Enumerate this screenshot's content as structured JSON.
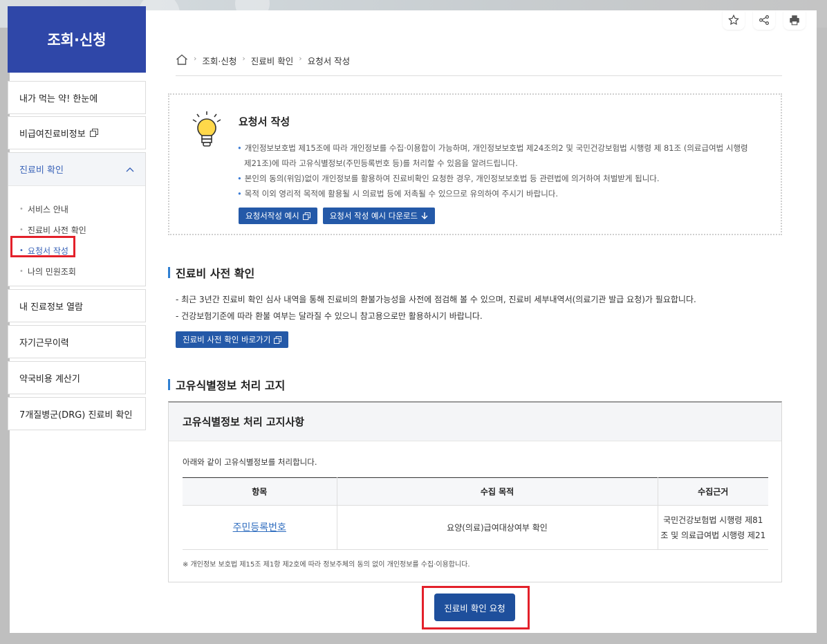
{
  "sidebar": {
    "title": "조회·신청",
    "items": [
      {
        "label": "내가 먹는 약! 한눈에"
      },
      {
        "label": "비급여진료비정보"
      },
      {
        "label": "진료비 확인"
      },
      {
        "label": "내 진료정보 열람"
      },
      {
        "label": "자기근무이력"
      },
      {
        "label": "약국비용 계산기"
      },
      {
        "label": "7개질병군(DRG) 진료비 확인"
      }
    ],
    "submenu": [
      {
        "label": "서비스 안내"
      },
      {
        "label": "진료비 사전 확인"
      },
      {
        "label": "요청서 작성"
      },
      {
        "label": "나의 민원조회"
      }
    ]
  },
  "breadcrumb": [
    "조회·신청",
    "진료비 확인",
    "요청서 작성"
  ],
  "info": {
    "title": "요청서 작성",
    "lines": [
      "개인정보보호법 제15조에 따라 개인정보를 수집·이용합이 가능하며, 개인정보보호법 제24조의2 및 국민건강보험법 시행령 제 81조 (의료급여법 시행령",
      "제21조)에 따라 고유식별정보(주민등록번호 등)를 처리할 수 있음을 알려드립니다.",
      "본인의 동의(위임)없이 개인정보를 활용하여 진료비확인 요청한 경우, 개인정보보호법 등 관련법에 의거하여 처벌받게 됩니다.",
      "목적 이외 영리적 목적에 활용될 시 의료법 등에 저촉될 수 있으므로 유의하여 주시기 바랍니다."
    ],
    "btn_example": "요청서작성 예시",
    "btn_download": "요청서 작성 예시 다운로드"
  },
  "section_pre": {
    "title": "진료비 사전 확인",
    "desc1": "- 최근 3년간 진료비 확인 심사 내역을 통해 진료비의 환불가능성을 사전에 점검해 볼 수 있으며, 진료비 세부내역서(의료기관 발급 요청)가 필요합니다.",
    "desc2": "- 건강보험기준에 따라 환불 여부는 달라질 수 있으니 참고용으로만 활용하시기 바랍니다.",
    "btn": "진료비 사전 확인 바로가기"
  },
  "section_notice": {
    "title": "고유식별정보 처리 고지",
    "box_title": "고유식별정보 처리 고지사항",
    "intro": "아래와 같이 고유식별정보를 처리합니다.",
    "headers": [
      "항목",
      "수집 목적",
      "수집근거"
    ],
    "row": {
      "item": "주민등록번호",
      "purpose": "요양(의료)급여대상여부 확인",
      "basis1": "국민건강보험법 시행령 제81",
      "basis2": "조 및 의료급여법 시행령 제21"
    },
    "footnote": "※ 개인정보 보호법 제15조 제1항 제2호에 따라 정보주체의 동의 없이 개인정보를 수집·이용합니다."
  },
  "main_button": "진료비 확인 요청"
}
